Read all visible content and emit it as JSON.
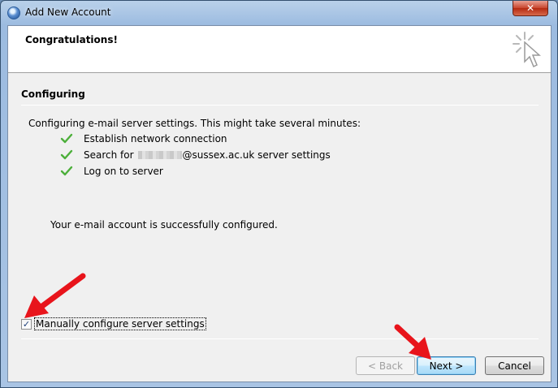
{
  "window": {
    "title": "Add New Account",
    "close_label": "✕"
  },
  "header": {
    "title": "Congratulations!"
  },
  "section": {
    "title": "Configuring",
    "description": "Configuring e-mail server settings. This might take several minutes:"
  },
  "steps": [
    {
      "text": "Establish network connection"
    },
    {
      "prefix": "Search for",
      "suffix": "@sussex.ac.uk server settings"
    },
    {
      "text": "Log on to server"
    }
  ],
  "success_message": "Your e-mail account is successfully configured.",
  "manual_config": {
    "label": "Manually configure server settings",
    "checked_mark": "✓"
  },
  "buttons": {
    "back": "< Back",
    "next": "Next >",
    "cancel": "Cancel"
  },
  "colors": {
    "check_green": "#4caf3a",
    "annotation_red": "#e8141b"
  }
}
